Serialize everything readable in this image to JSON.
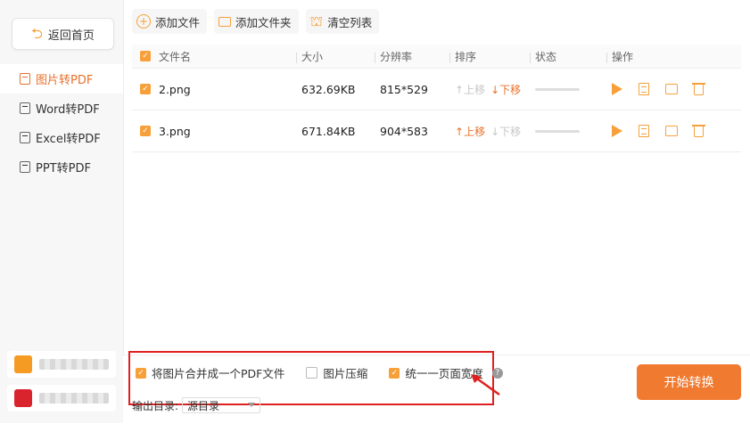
{
  "sidebar": {
    "back_label": "返回首页",
    "items": [
      {
        "label": "图片转PDF",
        "active": true
      },
      {
        "label": "Word转PDF",
        "active": false
      },
      {
        "label": "Excel转PDF",
        "active": false
      },
      {
        "label": "PPT转PDF",
        "active": false
      }
    ],
    "promo_colors": [
      "#f59a23",
      "#d9232d"
    ]
  },
  "toolbar": {
    "add_file": "添加文件",
    "add_folder": "添加文件夹",
    "clear_list": "清空列表"
  },
  "table": {
    "headers": {
      "name": "文件名",
      "size": "大小",
      "resolution": "分辨率",
      "sort": "排序",
      "status": "状态",
      "ops": "操作"
    },
    "rows": [
      {
        "name": "2.png",
        "size": "632.69KB",
        "resolution": "815*529",
        "up": "上移",
        "down": "下移",
        "up_enabled": false,
        "down_enabled": true
      },
      {
        "name": "3.png",
        "size": "671.84KB",
        "resolution": "904*583",
        "up": "上移",
        "down": "下移",
        "up_enabled": true,
        "down_enabled": false
      }
    ]
  },
  "options": {
    "merge": {
      "label": "将图片合并成一个PDF文件",
      "checked": true
    },
    "compress": {
      "label": "图片压缩",
      "checked": false
    },
    "uniform_width": {
      "label": "统一一页面宽度",
      "checked": true
    },
    "help": "?"
  },
  "output": {
    "label": "输出目录:",
    "value": "源目录"
  },
  "start_button": "开始转换",
  "colors": {
    "accent": "#f07a30",
    "highlight_box": "#e02020"
  }
}
